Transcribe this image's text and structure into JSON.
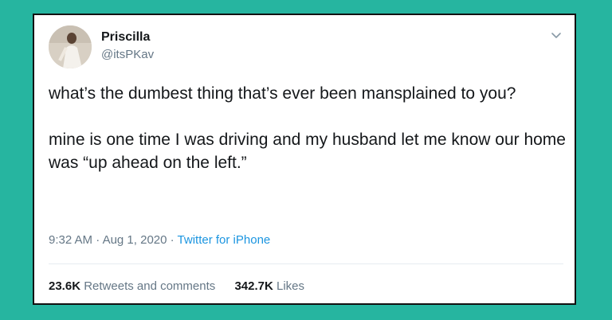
{
  "tweet": {
    "author": {
      "display_name": "Priscilla",
      "handle": "@itsPKav",
      "avatar_icon": "profile-photo"
    },
    "menu_icon": "chevron-down-icon",
    "text": "what’s the dumbest thing that’s ever been mansplained to you?\n\nmine is one time I was driving and my husband let me know our home was “up ahead on the left.”",
    "time": "9:32 AM",
    "date": "Aug 1, 2020",
    "separator": "·",
    "source": "Twitter for iPhone",
    "retweets": {
      "count": "23.6K",
      "label": "Retweets and comments"
    },
    "likes": {
      "count": "342.7K",
      "label": "Likes"
    }
  },
  "colors": {
    "background": "#26b5a0",
    "card": "#ffffff",
    "text": "#14171a",
    "secondary_text": "#657786",
    "link": "#1b95e0",
    "divider": "#e6ecf0"
  }
}
